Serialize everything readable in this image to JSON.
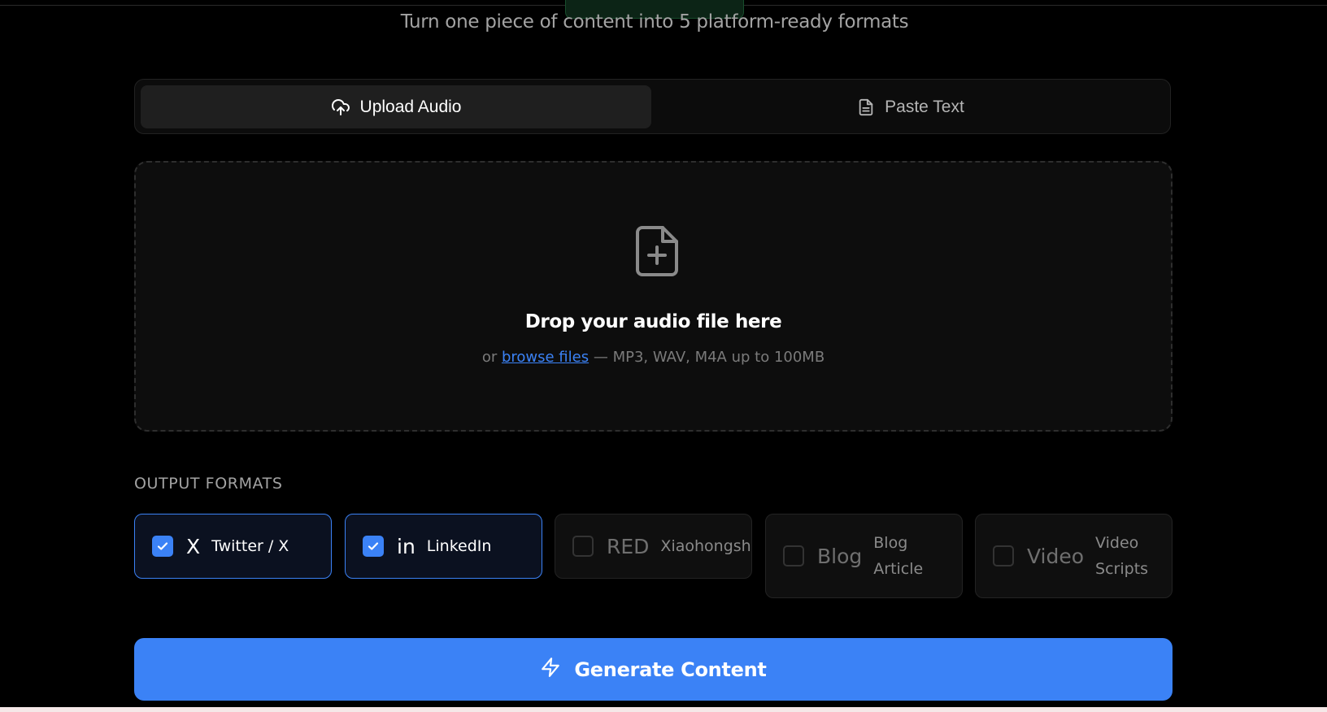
{
  "header": {
    "subtitle": "Turn one piece of content into 5 platform-ready formats"
  },
  "tabs": [
    {
      "label": "Upload Audio",
      "icon": "upload-cloud-icon",
      "active": true
    },
    {
      "label": "Paste Text",
      "icon": "document-icon",
      "active": false
    }
  ],
  "dropzone": {
    "icon": "file-plus-icon",
    "title": "Drop your audio file here",
    "hint_prefix": "or",
    "browse_link": "browse files",
    "hint_suffix": "— MP3, WAV, M4A up to 100MB"
  },
  "output_formats": {
    "label": "OUTPUT FORMATS",
    "items": [
      {
        "glyph": "X",
        "label": "Twitter / X",
        "checked": true
      },
      {
        "glyph": "in",
        "label": "LinkedIn",
        "checked": true
      },
      {
        "glyph": "RED",
        "label": "Xiaohongshu",
        "checked": false
      },
      {
        "glyph": "Blog",
        "label_line1": "Blog",
        "label_line2": "Article",
        "checked": false
      },
      {
        "glyph": "Video",
        "label_line1": "Video",
        "label_line2": "Scripts",
        "checked": false
      }
    ]
  },
  "generate_button": {
    "label": "Generate Content",
    "icon": "lightning-icon"
  },
  "colors": {
    "accent": "#3b82f6",
    "background": "#000000"
  }
}
